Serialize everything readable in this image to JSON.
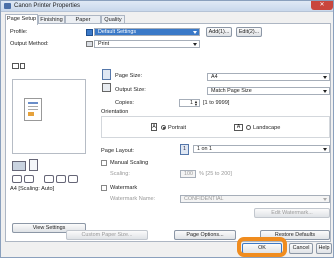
{
  "window": {
    "title": "Canon Printer Properties",
    "close": "✕"
  },
  "tabs": [
    {
      "label": "Page Setup",
      "active": true
    },
    {
      "label": "Finishing",
      "active": false
    },
    {
      "label": "Paper Source",
      "active": false
    },
    {
      "label": "Quality",
      "active": false
    }
  ],
  "profile": {
    "label": "Profile:",
    "value": "Default Settings",
    "add": "Add(1)...",
    "edit": "Edit(2)..."
  },
  "output_method": {
    "label": "Output Method:",
    "value": "Print"
  },
  "preview": {
    "caption": "A4 [Scaling: Auto]"
  },
  "page_size": {
    "label": "Page Size:",
    "value": "A4"
  },
  "output_size": {
    "label": "Output Size:",
    "value": "Match Page Size"
  },
  "copies": {
    "label": "Copies:",
    "value": "1",
    "range": "[1 to 9999]"
  },
  "orientation": {
    "label": "Orientation",
    "portrait": "Portrait",
    "landscape": "Landscape"
  },
  "page_layout": {
    "label": "Page Layout:",
    "value": "1 on 1"
  },
  "manual_scaling": {
    "label": "Manual Scaling"
  },
  "scaling": {
    "label": "Scaling:",
    "value": "100",
    "range": "% [25 to 200]"
  },
  "watermark": {
    "label": "Watermark",
    "name_label": "Watermark Name:",
    "value": "CONFIDENTIAL",
    "edit": "Edit Watermark..."
  },
  "view_settings": "View Settings",
  "buttons": {
    "custom_paper": "Custom Paper Size...",
    "page_options": "Page Options...",
    "restore_defaults": "Restore Defaults",
    "ok": "OK",
    "cancel": "Cancel",
    "help": "Help"
  },
  "colors": {
    "accent": "#3a79c8",
    "highlight_ring": "#f08c1e",
    "close": "#c9463d"
  }
}
